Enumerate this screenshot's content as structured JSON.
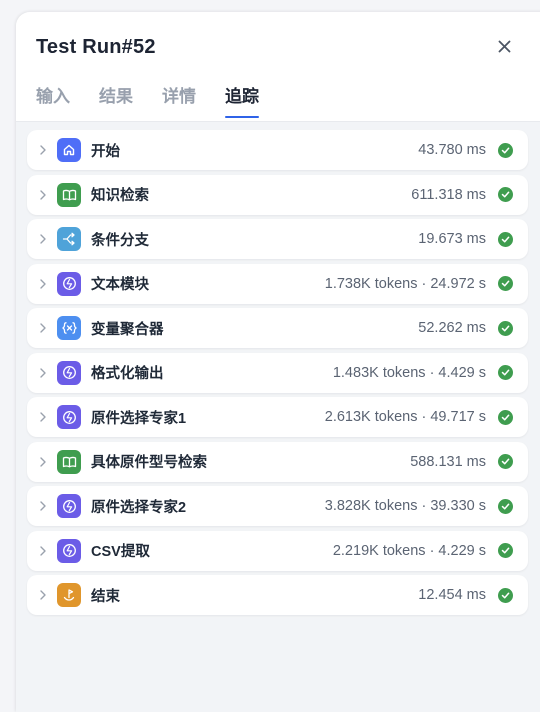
{
  "title": "Test Run#52",
  "tabs": [
    {
      "label": "输入",
      "active": false
    },
    {
      "label": "结果",
      "active": false
    },
    {
      "label": "详情",
      "active": false
    },
    {
      "label": "追踪",
      "active": true
    }
  ],
  "colors": {
    "accent": "#2f63e8",
    "success": "#3f9d4f",
    "start_icon": "#4f6ef7",
    "knowledge_icon": "#3f9d4f",
    "branch_icon": "#4fa3d9",
    "llm_icon": "#6b5ce7",
    "aggregator_icon": "#4d8ff0",
    "end_icon": "#e0962c"
  },
  "trace": [
    {
      "name": "开始",
      "metric": "43.780 ms",
      "icon": "home-icon",
      "status": "success"
    },
    {
      "name": "知识检索",
      "metric": "611.318 ms",
      "icon": "book-icon",
      "status": "success"
    },
    {
      "name": "条件分支",
      "metric": "19.673 ms",
      "icon": "branch-icon",
      "status": "success"
    },
    {
      "name": "文本模块",
      "metric": "1.738K tokens · 24.972 s",
      "icon": "llm-icon",
      "status": "success"
    },
    {
      "name": "变量聚合器",
      "metric": "52.262 ms",
      "icon": "variable-icon",
      "status": "success"
    },
    {
      "name": "格式化输出",
      "metric": "1.483K tokens · 4.429 s",
      "icon": "llm-icon",
      "status": "success"
    },
    {
      "name": "原件选择专家1",
      "metric": "2.613K tokens · 49.717 s",
      "icon": "llm-icon",
      "status": "success"
    },
    {
      "name": "具体原件型号检索",
      "metric": "588.131 ms",
      "icon": "book-icon",
      "status": "success"
    },
    {
      "name": "原件选择专家2",
      "metric": "3.828K tokens · 39.330 s",
      "icon": "llm-icon",
      "status": "success"
    },
    {
      "name": "CSV提取",
      "metric": "2.219K tokens · 4.229 s",
      "icon": "llm-icon",
      "status": "success"
    },
    {
      "name": "结束",
      "metric": "12.454 ms",
      "icon": "end-icon",
      "status": "success"
    }
  ]
}
